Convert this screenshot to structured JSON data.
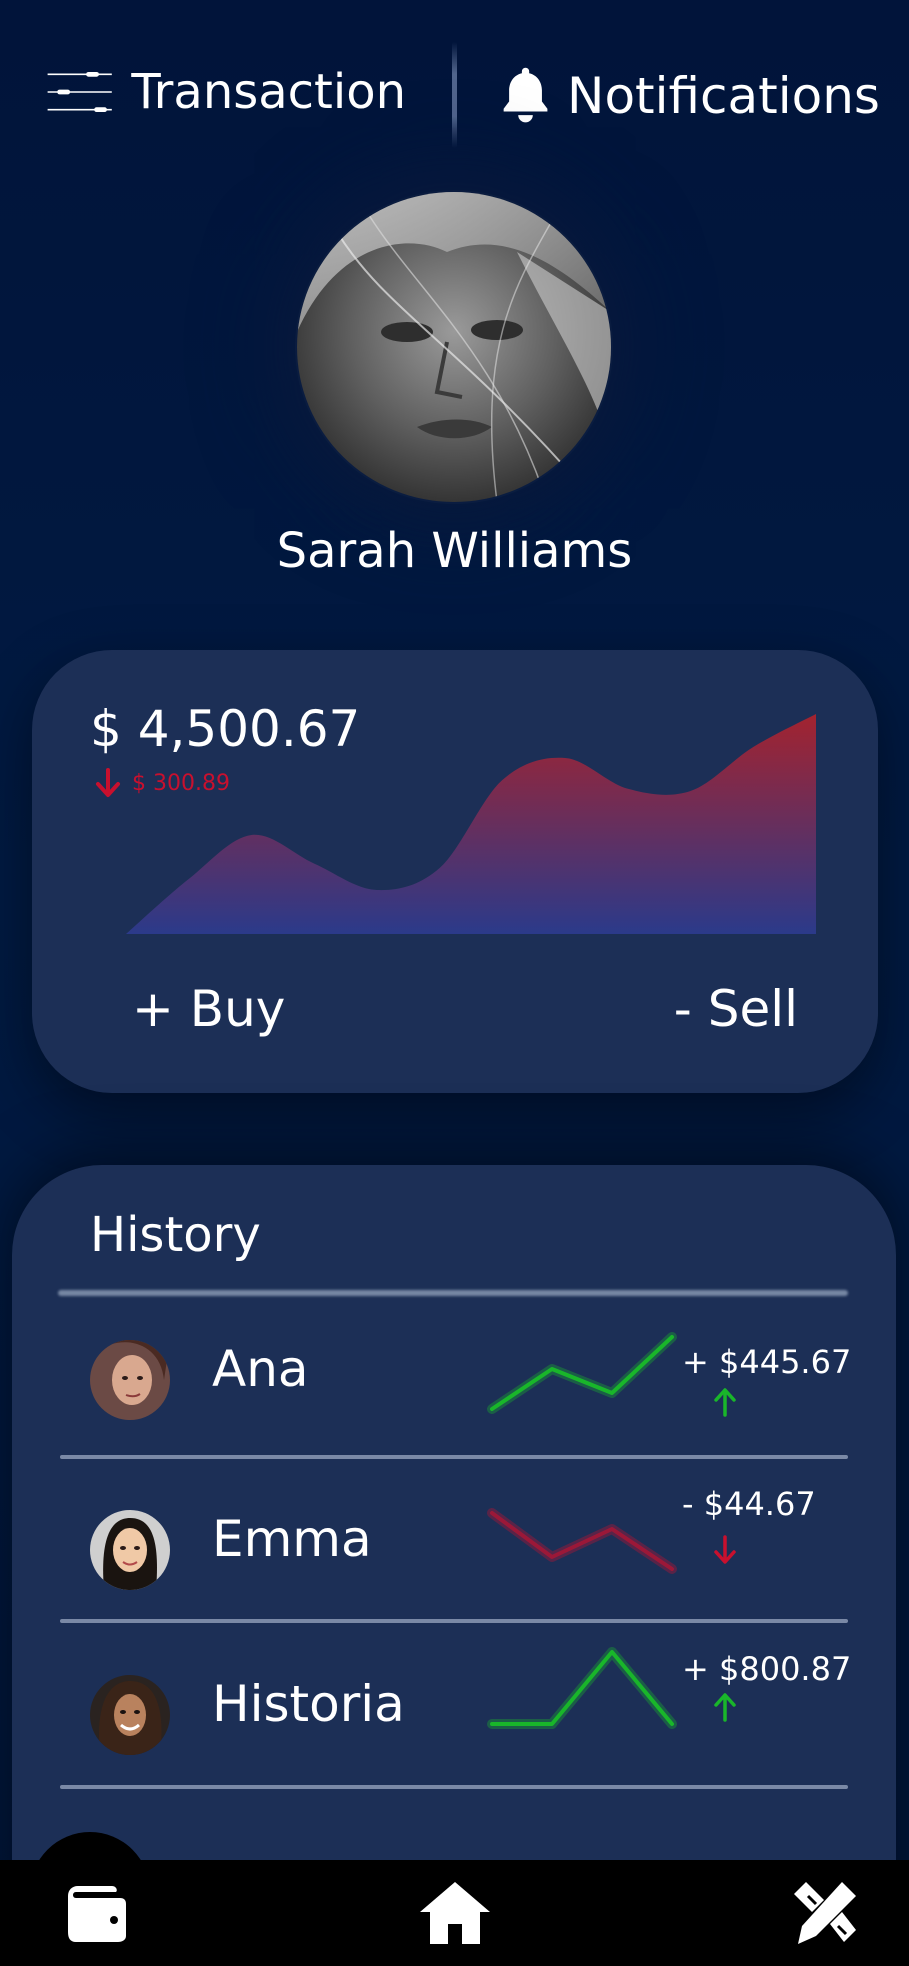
{
  "header": {
    "menu_title": "Transaction",
    "notifications_title": "Notifications"
  },
  "profile": {
    "name": "Sarah Williams"
  },
  "balance": {
    "amount": "$ 4,500.67",
    "change": "$ 300.89",
    "change_direction": "down",
    "buy_label": "+ Buy",
    "sell_label": "- Sell",
    "colors": {
      "card": "#1c2f56",
      "negative": "#c8102e",
      "area_top": "#a3232f",
      "area_bottom": "#2b3a8a"
    }
  },
  "chart_data": {
    "type": "area",
    "values": [
      0,
      25,
      45,
      32,
      20,
      30,
      70,
      80,
      66,
      65,
      85,
      100
    ],
    "title": "",
    "xlabel": "",
    "ylabel": ""
  },
  "history": {
    "title": "History",
    "items": [
      {
        "name": "Ana",
        "amount": "+ $445.67",
        "direction": "up",
        "trend": [
          10,
          60,
          30,
          100
        ]
      },
      {
        "name": "Emma",
        "amount": "- $44.67",
        "direction": "down",
        "trend": [
          80,
          25,
          60,
          10
        ]
      },
      {
        "name": "Historia",
        "amount": "+ $800.87",
        "direction": "up",
        "trend": [
          10,
          10,
          100,
          10
        ]
      }
    ],
    "colors": {
      "positive": "#19b62a",
      "negative": "#c8102e"
    }
  },
  "bottom_nav": {
    "items": [
      {
        "icon": "wallet-icon"
      },
      {
        "icon": "home-icon"
      },
      {
        "icon": "tools-icon"
      }
    ]
  }
}
